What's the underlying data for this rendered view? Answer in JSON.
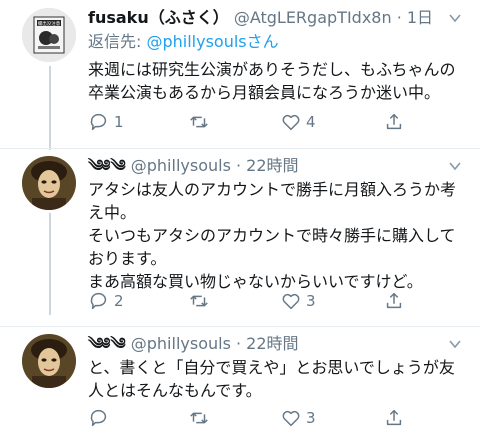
{
  "tweets": [
    {
      "name": "fusaku（ふさく）",
      "handle": "@AtgLERgapTIdx8n · 1日",
      "reply_prefix": "返信先: ",
      "reply_handle": "@phillysouls",
      "reply_suffix": "さん",
      "text": "来週には研究生公演がありそうだし、もふちゃんの\n卒業公演もあるから月額会員になろうか迷い中。",
      "reply_count": "1",
      "retweet_count": "",
      "like_count": "4",
      "avatar_text": "撮出没注意"
    },
    {
      "name_mark": "༄༅༄",
      "handle": "@phillysouls · 22時間",
      "text": "アタシは友人のアカウントで勝手に月額入ろうか考\nえ中。\nそいつもアタシのアカウントで時々勝手に購入して\nおります。\nまあ高額な買い物じゃないからいいですけど。",
      "reply_count": "2",
      "retweet_count": "",
      "like_count": "3"
    },
    {
      "name_mark": "༄༅༄",
      "handle": "@phillysouls · 22時間",
      "text": "と、書くと「自分で買えや」とお思いでしょうが友\n人とはそんなもんです。",
      "reply_count": "",
      "retweet_count": "",
      "like_count": "3"
    }
  ],
  "colors": {
    "accent": "#1da1f2",
    "secondary": "#657786",
    "line": "#ccd6dd"
  },
  "icons": [
    "chevron-down-icon",
    "reply-icon",
    "retweet-icon",
    "like-icon",
    "share-icon"
  ]
}
